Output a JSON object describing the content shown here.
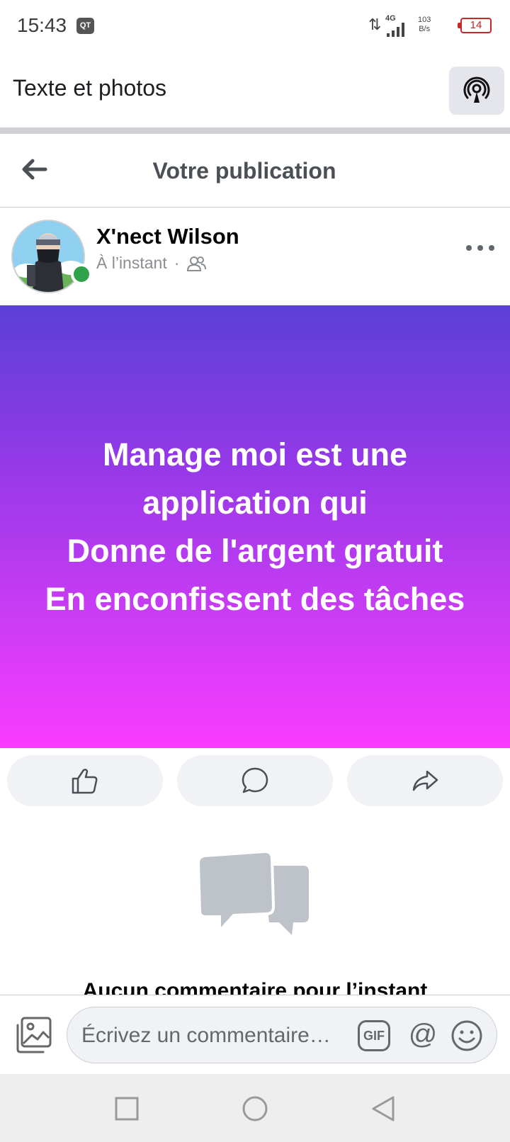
{
  "status_bar": {
    "time": "15:43",
    "app_icon_text": "QT",
    "network": "4G",
    "speed_value": "103",
    "speed_unit": "B/s",
    "battery": "14",
    "battery_color": "#c62828"
  },
  "app_header": {
    "title": "Texte et photos",
    "broadcast_icon": "broadcast-icon"
  },
  "post_nav": {
    "title": "Votre publication",
    "back_icon": "arrow-left-icon"
  },
  "author": {
    "name": "X'nect Wilson",
    "time": "À l’instant",
    "separator": "·",
    "audience_icon": "friends-icon",
    "online_color": "#31a24c"
  },
  "post": {
    "lines": [
      "Manage moi est une",
      "application qui",
      "Donne de l'argent gratuit",
      "En enconfissent des tâches"
    ],
    "gradient_top": "#5b40d8",
    "gradient_bottom": "#f93bff"
  },
  "actions": {
    "like_icon": "thumbs-up-icon",
    "comment_icon": "comment-bubble-icon",
    "share_icon": "share-arrow-icon"
  },
  "comments": {
    "empty_text": "Aucun commentaire pour l’instant"
  },
  "composer": {
    "placeholder": "Écrivez un commentaire…",
    "gif_label": "GIF",
    "mention_label": "@"
  }
}
